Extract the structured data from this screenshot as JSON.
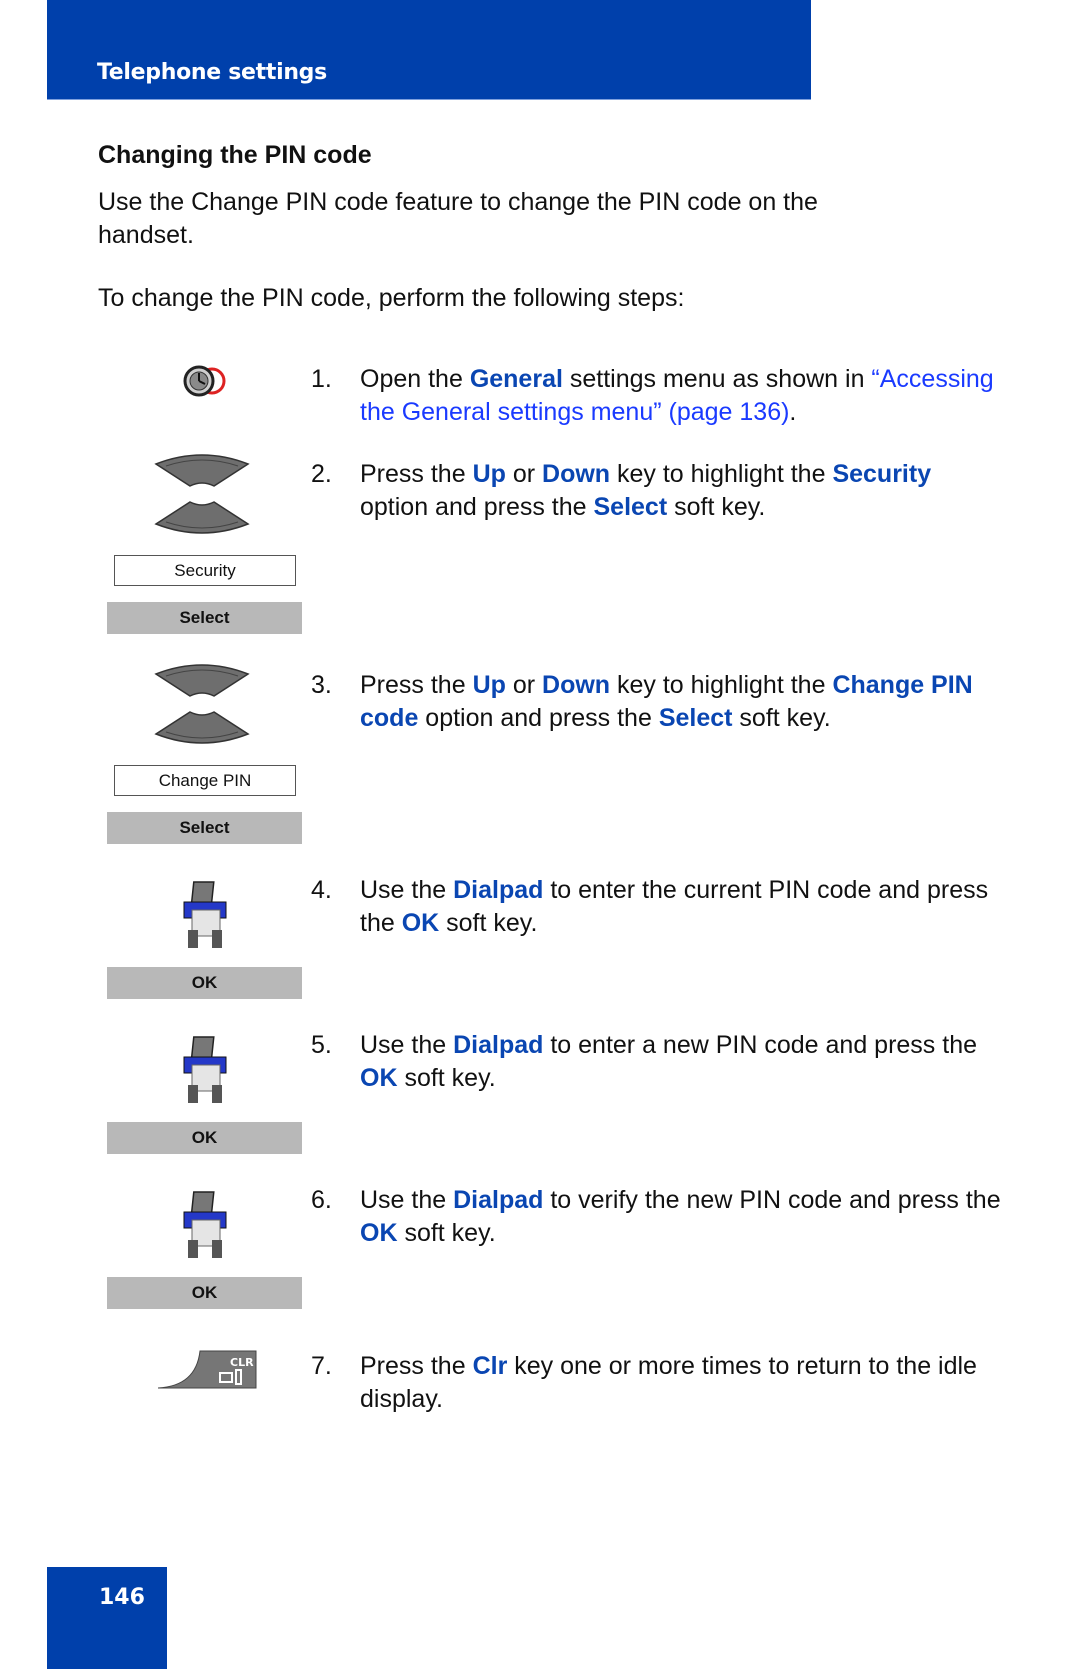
{
  "header": {
    "title": "Telephone settings"
  },
  "section": {
    "title": "Changing the PIN code",
    "intro": "Use the Change PIN code feature to change the PIN code on the handset.",
    "lead": "To change the PIN code, perform the following steps:"
  },
  "steps": [
    {
      "num": "1.",
      "parts": [
        "Open the ",
        "General",
        " settings menu as shown in "
      ],
      "link": "“Accessing the General settings menu” (page 136)",
      "after": "."
    },
    {
      "num": "2.",
      "parts": [
        "Press the ",
        "Up",
        " or ",
        "Down",
        " key to highlight the ",
        "Security",
        " option and press the ",
        "Select",
        " soft key."
      ]
    },
    {
      "num": "3.",
      "parts": [
        "Press the ",
        "Up",
        " or ",
        "Down",
        " key to highlight the ",
        "Change PIN code",
        " option and press the ",
        "Select",
        " soft key."
      ]
    },
    {
      "num": "4.",
      "parts": [
        "Use the ",
        "Dialpad",
        " to enter the current PIN code and press the ",
        "OK",
        " soft key."
      ]
    },
    {
      "num": "5.",
      "parts": [
        "Use the ",
        "Dialpad",
        " to enter a new PIN code and press the ",
        "OK",
        " soft key."
      ]
    },
    {
      "num": "6.",
      "parts": [
        "Use the ",
        "Dialpad",
        " to verify the new PIN code and press the ",
        "OK",
        " soft key."
      ]
    },
    {
      "num": "7.",
      "parts": [
        "Press the ",
        "Clr",
        " key one or more times to return to the idle display."
      ]
    }
  ],
  "icons": {
    "step1": "settings-clock-icon",
    "step2": "up-down-navigation-key-icon",
    "step3": "up-down-navigation-key-icon",
    "step4": "dialpad-handset-icon",
    "step5": "dialpad-handset-icon",
    "step6": "dialpad-handset-icon",
    "step7": "clr-key-icon"
  },
  "displays": {
    "step2": "Security",
    "step3": "Change PIN"
  },
  "softkeys": {
    "step2": "Select",
    "step3": "Select",
    "step4": "OK",
    "step5": "OK",
    "step6": "OK"
  },
  "clr_key_label": "CLR",
  "footer": {
    "page_number": "146"
  },
  "colors": {
    "brand_blue": "#0040ab",
    "keyword_blue": "#0a46b2",
    "link_blue": "#1a3aff",
    "softkey_gray": "#b8b8b8"
  }
}
